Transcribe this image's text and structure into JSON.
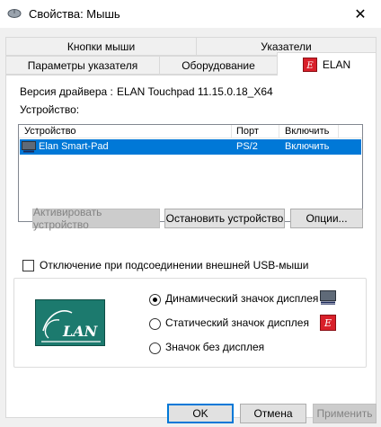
{
  "window": {
    "title": "Свойства: Мышь",
    "close_glyph": "✕"
  },
  "tabs": {
    "row1": [
      "Кнопки мыши",
      "Указатели"
    ],
    "row2": [
      "Параметры указателя",
      "Оборудование",
      "ELAN"
    ],
    "active": "ELAN"
  },
  "driver": {
    "version_label": "Версия драйвера :",
    "version_value": "ELAN Touchpad 11.15.0.18_X64",
    "devices_label": "Устройство:"
  },
  "device_list": {
    "columns": [
      "Устройство",
      "Порт",
      "Включить"
    ],
    "rows": [
      {
        "device": "Elan Smart-Pad",
        "port": "PS/2",
        "enable": "Включить",
        "selected": true
      }
    ]
  },
  "device_buttons": {
    "activate": "Активировать устройство",
    "stop": "Остановить устройство",
    "options": "Опции..."
  },
  "usb_checkbox": {
    "label": "Отключение при подсоединении внешней USB-мыши",
    "checked": false
  },
  "display_icon": {
    "options": [
      {
        "label": "Динамический значок дисплея",
        "checked": true,
        "icon": "monitor-icon"
      },
      {
        "label": "Статический значок дисплея",
        "checked": false,
        "icon": "elan-red-icon"
      },
      {
        "label": "Значок без дисплея",
        "checked": false,
        "icon": ""
      }
    ],
    "logo_text": "LAN"
  },
  "footer": {
    "ok": "OK",
    "cancel": "Отмена",
    "apply": "Применить"
  },
  "colors": {
    "selection": "#0078d7",
    "elan_green": "#1c7a6e",
    "elan_red": "#d9202a",
    "dialog_bg": "#f0f0f0"
  }
}
